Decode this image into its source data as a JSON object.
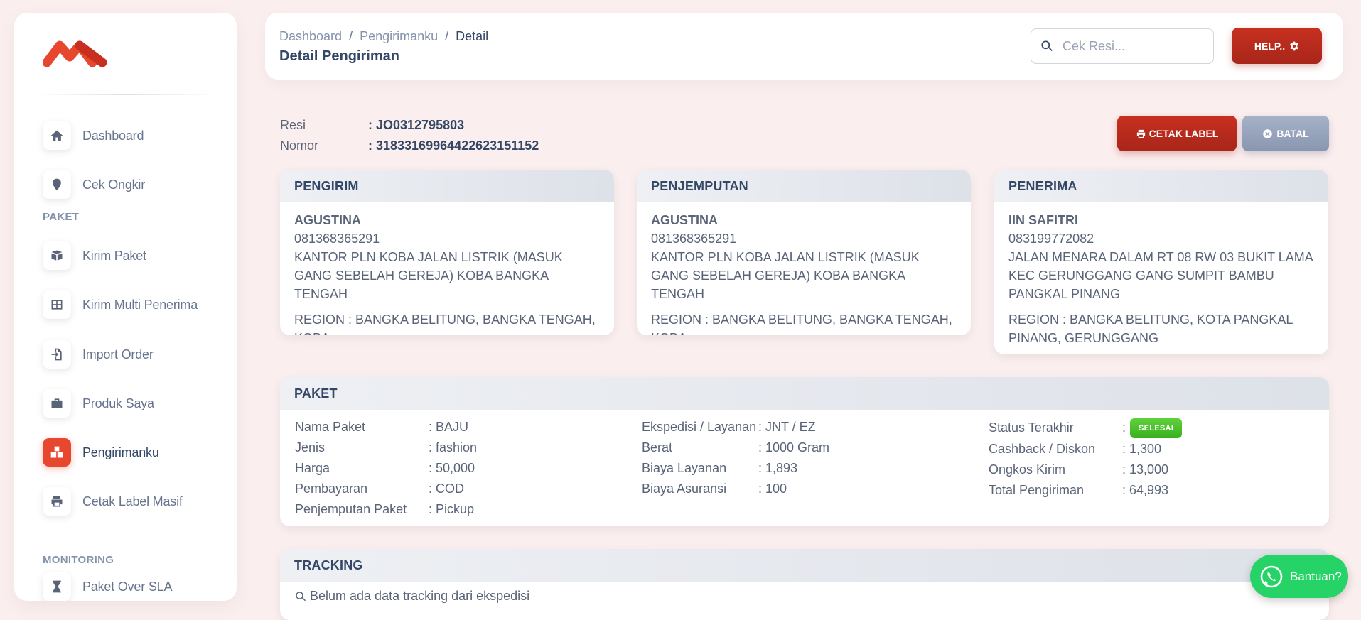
{
  "sidebar": {
    "nav_top": [
      {
        "label": "Dashboard",
        "icon": "home-icon"
      },
      {
        "label": "Cek Ongkir",
        "icon": "map-pin-icon"
      }
    ],
    "section_paket": "PAKET",
    "nav_paket": [
      {
        "label": "Kirim Paket",
        "icon": "box-icon"
      },
      {
        "label": "Kirim Multi Penerima",
        "icon": "grid-icon"
      },
      {
        "label": "Import Order",
        "icon": "import-icon"
      },
      {
        "label": "Produk Saya",
        "icon": "briefcase-icon"
      },
      {
        "label": "Pengirimanku",
        "icon": "boxes-icon",
        "active": true
      },
      {
        "label": "Cetak Label Masif",
        "icon": "printer-icon"
      }
    ],
    "section_monitoring": "MONITORING",
    "nav_monitoring": [
      {
        "label": "Paket Over SLA",
        "icon": "hourglass-icon"
      }
    ]
  },
  "header": {
    "breadcrumb": [
      "Dashboard",
      "Pengirimanku",
      "Detail"
    ],
    "separator": "/",
    "title": "Detail Pengiriman",
    "search_placeholder": "Cek Resi...",
    "help_label": "HELP.."
  },
  "shipment": {
    "resi_label": "Resi",
    "resi_value": ": JO0312795803",
    "nomor_label": "Nomor",
    "nomor_value": ": 31833169964422623151152",
    "cetak_label": "CETAK LABEL",
    "batal_label": "BATAL"
  },
  "pengirim": {
    "title": "PENGIRIM",
    "name": "AGUSTINA",
    "phone": "081368365291",
    "address": "KANTOR PLN KOBA JALAN LISTRIK (MASUK GANG SEBELAH GEREJA) KOBA BANGKA TENGAH",
    "region": "REGION : BANGKA BELITUNG, BANGKA TENGAH, KOBA"
  },
  "penjemputan": {
    "title": "PENJEMPUTAN",
    "name": "AGUSTINA",
    "phone": "081368365291",
    "address": "KANTOR PLN KOBA JALAN LISTRIK (MASUK GANG SEBELAH GEREJA) KOBA BANGKA TENGAH",
    "region": "REGION : BANGKA BELITUNG, BANGKA TENGAH, KOBA"
  },
  "penerima": {
    "title": "PENERIMA",
    "name": "IIN SAFITRI",
    "phone": "083199772082",
    "address": "JALAN MENARA DALAM RT 08 RW 03 BUKIT LAMA KEC GERUNGGANG GANG SUMPIT BAMBU PANGKAL PINANG",
    "region": "REGION : BANGKA BELITUNG, KOTA PANGKAL PINANG, GERUNGGANG"
  },
  "paket": {
    "title": "PAKET",
    "col1": [
      {
        "k": "Nama Paket",
        "v": ": BAJU"
      },
      {
        "k": "Jenis",
        "v": ": fashion"
      },
      {
        "k": "Harga",
        "v": ": 50,000"
      },
      {
        "k": "Pembayaran",
        "v": ": COD"
      },
      {
        "k": "Penjemputan Paket",
        "v": ": Pickup"
      }
    ],
    "col2": [
      {
        "k": "Ekspedisi / Layanan",
        "v": ": JNT / EZ"
      },
      {
        "k": "Berat",
        "v": ": 1000 Gram"
      },
      {
        "k": "Biaya Layanan",
        "v": ": 1,893"
      },
      {
        "k": "Biaya Asuransi",
        "v": ": 100"
      }
    ],
    "status_label": "Status Terakhir",
    "status_colon": ":",
    "status_badge": "SELESAI",
    "col3": [
      {
        "k": "Cashback / Diskon",
        "v": ": 1,300"
      },
      {
        "k": "Ongkos Kirim",
        "v": ": 13,000"
      },
      {
        "k": "Total Pengiriman",
        "v": ": 64,993"
      }
    ]
  },
  "tracking": {
    "title": "TRACKING",
    "empty_text": "Belum ada data tracking dari ekspedisi"
  },
  "whatsapp": {
    "label": "Bantuan?"
  },
  "colors": {
    "accent": "#e8472f",
    "primary_button": "#b82a1c",
    "secondary_button": "#98a4bd",
    "success_badge": "#4cc22a",
    "whatsapp": "#25d366"
  }
}
